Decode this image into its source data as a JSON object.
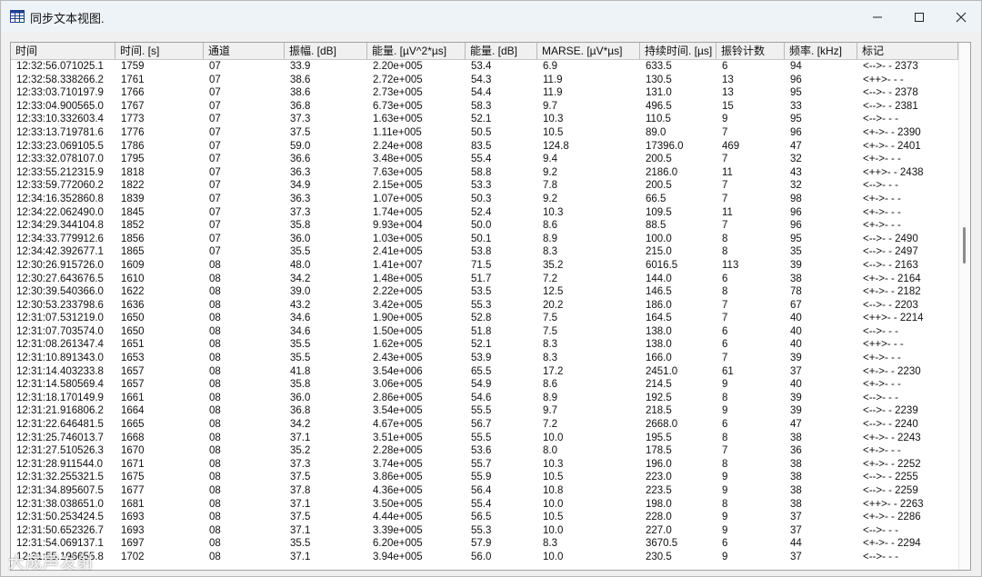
{
  "window": {
    "title": "同步文本视图.",
    "icons": {
      "app": "table-icon",
      "minimize": "minimize-icon",
      "maximize": "maximize-icon",
      "close": "close-icon"
    }
  },
  "table": {
    "columns": [
      "时间",
      "时间. [s]",
      "通道",
      "振幅. [dB]",
      "能量. [µV^2*µs]",
      "能量. [dB]",
      "MARSE. [µV*µs]",
      "持续时间. [µs]",
      "振铃计数",
      "频率. [kHz]",
      "标记"
    ],
    "rows": [
      [
        "12:32:56.071025.1",
        "1759",
        "07",
        "33.9",
        "2.20e+005",
        "53.4",
        "6.9",
        "633.5",
        "6",
        "94",
        "<-->-  - 2373"
      ],
      [
        "12:32:58.338266.2",
        "1761",
        "07",
        "38.6",
        "2.72e+005",
        "54.3",
        "11.9",
        "130.5",
        "13",
        "96",
        "<++>-  -  -"
      ],
      [
        "12:33:03.710197.9",
        "1766",
        "07",
        "38.6",
        "2.73e+005",
        "54.4",
        "11.9",
        "131.0",
        "13",
        "95",
        "<-->-  - 2378"
      ],
      [
        "12:33:04.900565.0",
        "1767",
        "07",
        "36.8",
        "6.73e+005",
        "58.3",
        "9.7",
        "496.5",
        "15",
        "33",
        "<-->-  - 2381"
      ],
      [
        "12:33:10.332603.4",
        "1773",
        "07",
        "37.3",
        "1.63e+005",
        "52.1",
        "10.3",
        "110.5",
        "9",
        "95",
        "<-->-  -  -"
      ],
      [
        "12:33:13.719781.6",
        "1776",
        "07",
        "37.5",
        "1.11e+005",
        "50.5",
        "10.5",
        "89.0",
        "7",
        "96",
        "<+->-  - 2390"
      ],
      [
        "12:33:23.069105.5",
        "1786",
        "07",
        "59.0",
        "2.24e+008",
        "83.5",
        "124.8",
        "17396.0",
        "469",
        "47",
        "<+->-  - 2401"
      ],
      [
        "12:33:32.078107.0",
        "1795",
        "07",
        "36.6",
        "3.48e+005",
        "55.4",
        "9.4",
        "200.5",
        "7",
        "32",
        "<+->-  -  -"
      ],
      [
        "12:33:55.212315.9",
        "1818",
        "07",
        "36.3",
        "7.63e+005",
        "58.8",
        "9.2",
        "2186.0",
        "11",
        "43",
        "<++>-  - 2438"
      ],
      [
        "12:33:59.772060.2",
        "1822",
        "07",
        "34.9",
        "2.15e+005",
        "53.3",
        "7.8",
        "200.5",
        "7",
        "32",
        "<-->-  -  -"
      ],
      [
        "12:34:16.352860.8",
        "1839",
        "07",
        "36.3",
        "1.07e+005",
        "50.3",
        "9.2",
        "66.5",
        "7",
        "98",
        "<+->-  -  -"
      ],
      [
        "12:34:22.062490.0",
        "1845",
        "07",
        "37.3",
        "1.74e+005",
        "52.4",
        "10.3",
        "109.5",
        "11",
        "96",
        "<+->-  -  -"
      ],
      [
        "12:34:29.344104.8",
        "1852",
        "07",
        "35.8",
        "9.93e+004",
        "50.0",
        "8.6",
        "88.5",
        "7",
        "96",
        "<+->-  -  -"
      ],
      [
        "12:34:33.779912.6",
        "1856",
        "07",
        "36.0",
        "1.03e+005",
        "50.1",
        "8.9",
        "100.0",
        "8",
        "95",
        "<-->-  - 2490"
      ],
      [
        "12:34:42.392677.1",
        "1865",
        "07",
        "35.5",
        "2.41e+005",
        "53.8",
        "8.3",
        "215.0",
        "8",
        "35",
        "<-->-  - 2497"
      ],
      [
        "12:30:26.915726.0",
        "1609",
        "08",
        "48.0",
        "1.41e+007",
        "71.5",
        "35.2",
        "6016.5",
        "113",
        "39",
        "<-->-  - 2163"
      ],
      [
        "12:30:27.643676.5",
        "1610",
        "08",
        "34.2",
        "1.48e+005",
        "51.7",
        "7.2",
        "144.0",
        "6",
        "38",
        "<+->-  - 2164"
      ],
      [
        "12:30:39.540366.0",
        "1622",
        "08",
        "39.0",
        "2.22e+005",
        "53.5",
        "12.5",
        "146.5",
        "8",
        "78",
        "<+->-  - 2182"
      ],
      [
        "12:30:53.233798.6",
        "1636",
        "08",
        "43.2",
        "3.42e+005",
        "55.3",
        "20.2",
        "186.0",
        "7",
        "67",
        "<-->-  - 2203"
      ],
      [
        "12:31:07.531219.0",
        "1650",
        "08",
        "34.6",
        "1.90e+005",
        "52.8",
        "7.5",
        "164.5",
        "7",
        "40",
        "<++>-  - 2214"
      ],
      [
        "12:31:07.703574.0",
        "1650",
        "08",
        "34.6",
        "1.50e+005",
        "51.8",
        "7.5",
        "138.0",
        "6",
        "40",
        "<-->-  -  -"
      ],
      [
        "12:31:08.261347.4",
        "1651",
        "08",
        "35.5",
        "1.62e+005",
        "52.1",
        "8.3",
        "138.0",
        "6",
        "40",
        "<++>-  -  -"
      ],
      [
        "12:31:10.891343.0",
        "1653",
        "08",
        "35.5",
        "2.43e+005",
        "53.9",
        "8.3",
        "166.0",
        "7",
        "39",
        "<+->-  -  -"
      ],
      [
        "12:31:14.403233.8",
        "1657",
        "08",
        "41.8",
        "3.54e+006",
        "65.5",
        "17.2",
        "2451.0",
        "61",
        "37",
        "<+->-  - 2230"
      ],
      [
        "12:31:14.580569.4",
        "1657",
        "08",
        "35.8",
        "3.06e+005",
        "54.9",
        "8.6",
        "214.5",
        "9",
        "40",
        "<+->-  -  -"
      ],
      [
        "12:31:18.170149.9",
        "1661",
        "08",
        "36.0",
        "2.86e+005",
        "54.6",
        "8.9",
        "192.5",
        "8",
        "39",
        "<-->-  -  -"
      ],
      [
        "12:31:21.916806.2",
        "1664",
        "08",
        "36.8",
        "3.54e+005",
        "55.5",
        "9.7",
        "218.5",
        "9",
        "39",
        "<-->-  - 2239"
      ],
      [
        "12:31:22.646481.5",
        "1665",
        "08",
        "34.2",
        "4.67e+005",
        "56.7",
        "7.2",
        "2668.0",
        "6",
        "47",
        "<-->-  - 2240"
      ],
      [
        "12:31:25.746013.7",
        "1668",
        "08",
        "37.1",
        "3.51e+005",
        "55.5",
        "10.0",
        "195.5",
        "8",
        "38",
        "<+->-  - 2243"
      ],
      [
        "12:31:27.510526.3",
        "1670",
        "08",
        "35.2",
        "2.28e+005",
        "53.6",
        "8.0",
        "178.5",
        "7",
        "36",
        "<+->-  -  -"
      ],
      [
        "12:31:28.911544.0",
        "1671",
        "08",
        "37.3",
        "3.74e+005",
        "55.7",
        "10.3",
        "196.0",
        "8",
        "38",
        "<+->-  - 2252"
      ],
      [
        "12:31:32.255321.5",
        "1675",
        "08",
        "37.5",
        "3.86e+005",
        "55.9",
        "10.5",
        "223.0",
        "9",
        "38",
        "<-->-  - 2255"
      ],
      [
        "12:31:34.895607.5",
        "1677",
        "08",
        "37.8",
        "4.36e+005",
        "56.4",
        "10.8",
        "223.5",
        "9",
        "38",
        "<-->-  - 2259"
      ],
      [
        "12:31:38.038651.0",
        "1681",
        "08",
        "37.1",
        "3.50e+005",
        "55.4",
        "10.0",
        "198.0",
        "8",
        "38",
        "<++>-  - 2263"
      ],
      [
        "12:31:50.253424.5",
        "1693",
        "08",
        "37.5",
        "4.44e+005",
        "56.5",
        "10.5",
        "228.0",
        "9",
        "37",
        "<+->-  - 2286"
      ],
      [
        "12:31:50.652326.7",
        "1693",
        "08",
        "37.1",
        "3.39e+005",
        "55.3",
        "10.0",
        "227.0",
        "9",
        "37",
        "<-->-  -  -"
      ],
      [
        "12:31:54.069137.1",
        "1697",
        "08",
        "35.5",
        "6.20e+005",
        "57.9",
        "8.3",
        "3670.5",
        "6",
        "44",
        "<+->-  - 2294"
      ],
      [
        "12:31:55.196655.8",
        "1702",
        "08",
        "37.1",
        "3.94e+005",
        "56.0",
        "10.0",
        "230.5",
        "9",
        "37",
        "<-->-  -  -"
      ]
    ]
  },
  "watermark": "大成声发射"
}
